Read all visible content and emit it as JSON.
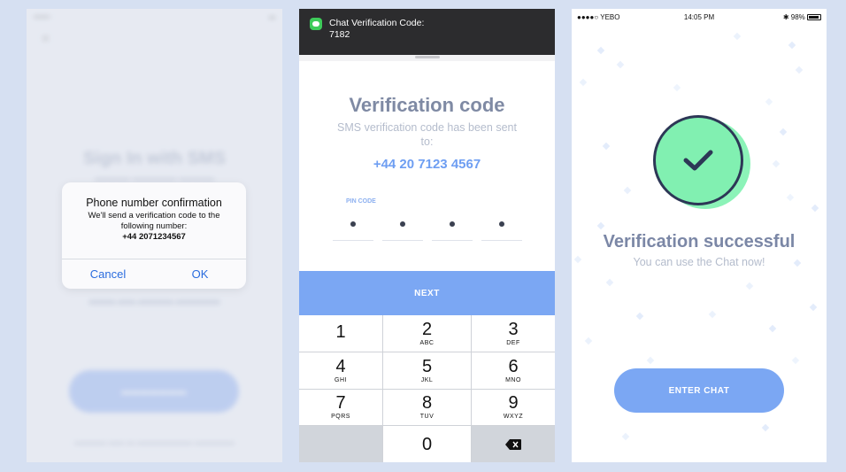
{
  "screen1": {
    "title": "Sign In with SMS",
    "alert": {
      "title": "Phone number confirmation",
      "message": "We'll send a verification code to the following number:",
      "number": "+44 2071234567",
      "cancel_label": "Cancel",
      "ok_label": "OK"
    }
  },
  "screen2": {
    "notification": {
      "title": "Chat Verification Code:",
      "code": "7182"
    },
    "title": "Verification code",
    "subtitle": "SMS verification code has been sent to:",
    "phone": "+44 20 7123 4567",
    "pin_label": "PIN CODE",
    "pin_digits_entered": 4,
    "next_label": "NEXT",
    "keys": [
      {
        "digit": "1",
        "letters": ""
      },
      {
        "digit": "2",
        "letters": "ABC"
      },
      {
        "digit": "3",
        "letters": "DEF"
      },
      {
        "digit": "4",
        "letters": "GHI"
      },
      {
        "digit": "5",
        "letters": "JKL"
      },
      {
        "digit": "6",
        "letters": "MNO"
      },
      {
        "digit": "7",
        "letters": "PQRS"
      },
      {
        "digit": "8",
        "letters": "TUV"
      },
      {
        "digit": "9",
        "letters": "WXYZ"
      },
      {
        "digit": "0",
        "letters": ""
      }
    ]
  },
  "screen3": {
    "status": {
      "carrier": "●●●●○ YEBO",
      "time": "14:05 PM",
      "battery": "98%"
    },
    "title": "Verification successful",
    "subtitle": "You can use the Chat now!",
    "enter_label": "ENTER CHAT"
  },
  "colors": {
    "background": "#d6e0f2",
    "accent_blue": "#7ba7f3",
    "success_green": "#81f0b1",
    "dark_navy": "#2d3756"
  }
}
